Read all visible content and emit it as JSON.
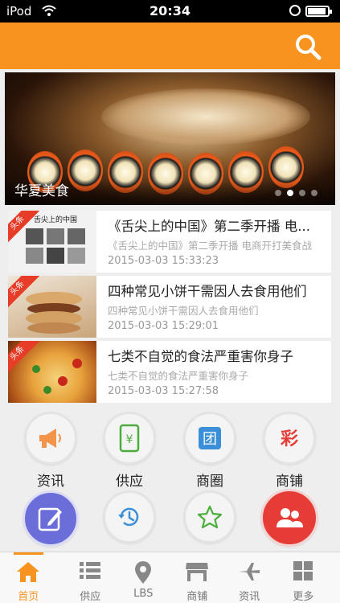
{
  "status": {
    "carrier": "iPod",
    "time": "20:34"
  },
  "banner": {
    "title": "华夏美食",
    "slide_count": 4,
    "active_slide": 2
  },
  "news": [
    {
      "badge": "头条",
      "title": "《舌尖上的中国》第二季开播 电...",
      "summary": "《舌尖上的中国》第二季开播 电商开打美食战",
      "date": "2015-03-03 15:33:23",
      "thumb_title": "舌尖上的中国"
    },
    {
      "badge": "头条",
      "title": "四种常见小饼干需因人去食用他们",
      "summary": "四种常见小饼干需因人去食用他们",
      "date": "2015-03-03 15:29:01"
    },
    {
      "badge": "头条",
      "title": "七类不自觉的食法严重害你身子",
      "summary": "七类不自觉的食法严重害你身子",
      "date": "2015-03-03 15:27:58"
    }
  ],
  "grid": {
    "row1": [
      {
        "label": "资讯",
        "icon": "megaphone-icon"
      },
      {
        "label": "供应",
        "icon": "phone-yen-icon"
      },
      {
        "label": "商圈",
        "icon": "group-tuan-icon"
      },
      {
        "label": "商铺",
        "icon": "lottery-cai-icon"
      }
    ],
    "row2": [
      {
        "icon": "edit-icon"
      },
      {
        "icon": "history-icon"
      },
      {
        "icon": "star-icon"
      },
      {
        "icon": "contacts-icon"
      }
    ],
    "tuan_char": "团",
    "cai_char": "彩"
  },
  "tabs": [
    {
      "label": "首页",
      "icon": "home-icon",
      "active": true
    },
    {
      "label": "供应",
      "icon": "list-icon"
    },
    {
      "label": "LBS",
      "icon": "location-pin-icon"
    },
    {
      "label": "商铺",
      "icon": "shop-icon"
    },
    {
      "label": "资讯",
      "icon": "plane-icon"
    },
    {
      "label": "更多",
      "icon": "grid-icon"
    }
  ],
  "colors": {
    "accent": "#f7931e",
    "badge": "#e63c28",
    "edit_circle": "#6b6ed9",
    "contacts_circle": "#e63c36"
  }
}
